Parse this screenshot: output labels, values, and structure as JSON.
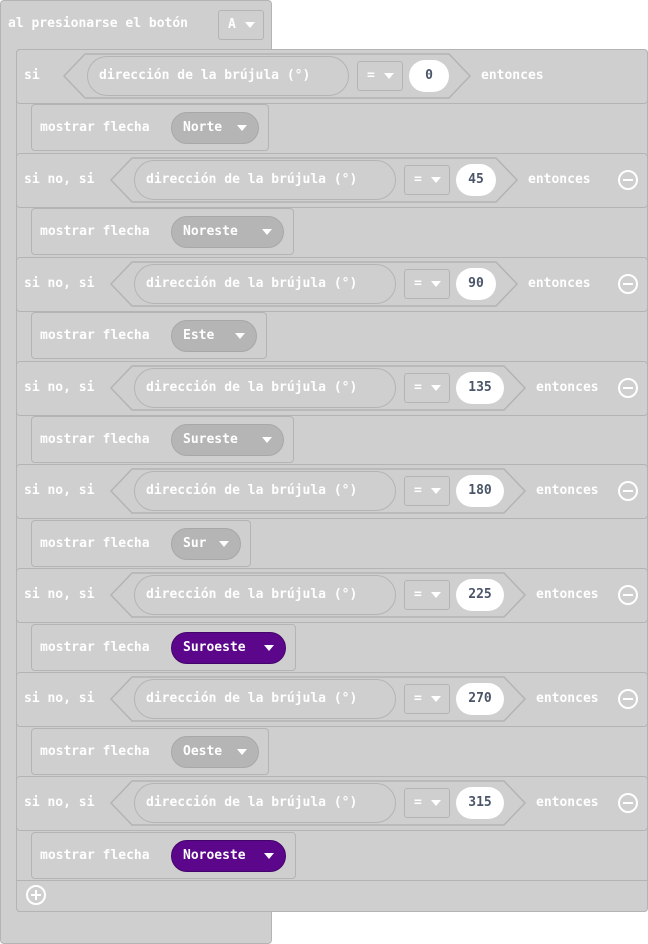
{
  "event": {
    "label": "al presionarse el botón",
    "button_value": "A"
  },
  "if_label": "si",
  "elseif_label": "si no, si",
  "then_label": "entonces",
  "compass_label": "dirección de la brújula (°)",
  "operator": "=",
  "show_arrow_label": "mostrar flecha",
  "branches": [
    {
      "value": "0",
      "direction": "Norte"
    },
    {
      "value": "45",
      "direction": "Noreste"
    },
    {
      "value": "90",
      "direction": "Este"
    },
    {
      "value": "135",
      "direction": "Sureste"
    },
    {
      "value": "180",
      "direction": "Sur"
    },
    {
      "value": "225",
      "direction": "Suroeste"
    },
    {
      "value": "270",
      "direction": "Oeste"
    },
    {
      "value": "315",
      "direction": "Noroeste"
    }
  ],
  "colors": {
    "block": "#cfcfcf",
    "border": "#b4b4b4",
    "dropdown": "#b5b5b5",
    "highlight": "#5c068c"
  },
  "icons": {
    "remove": "minus-circle-icon",
    "add": "plus-circle-icon",
    "dropdown": "caret-down-icon"
  }
}
